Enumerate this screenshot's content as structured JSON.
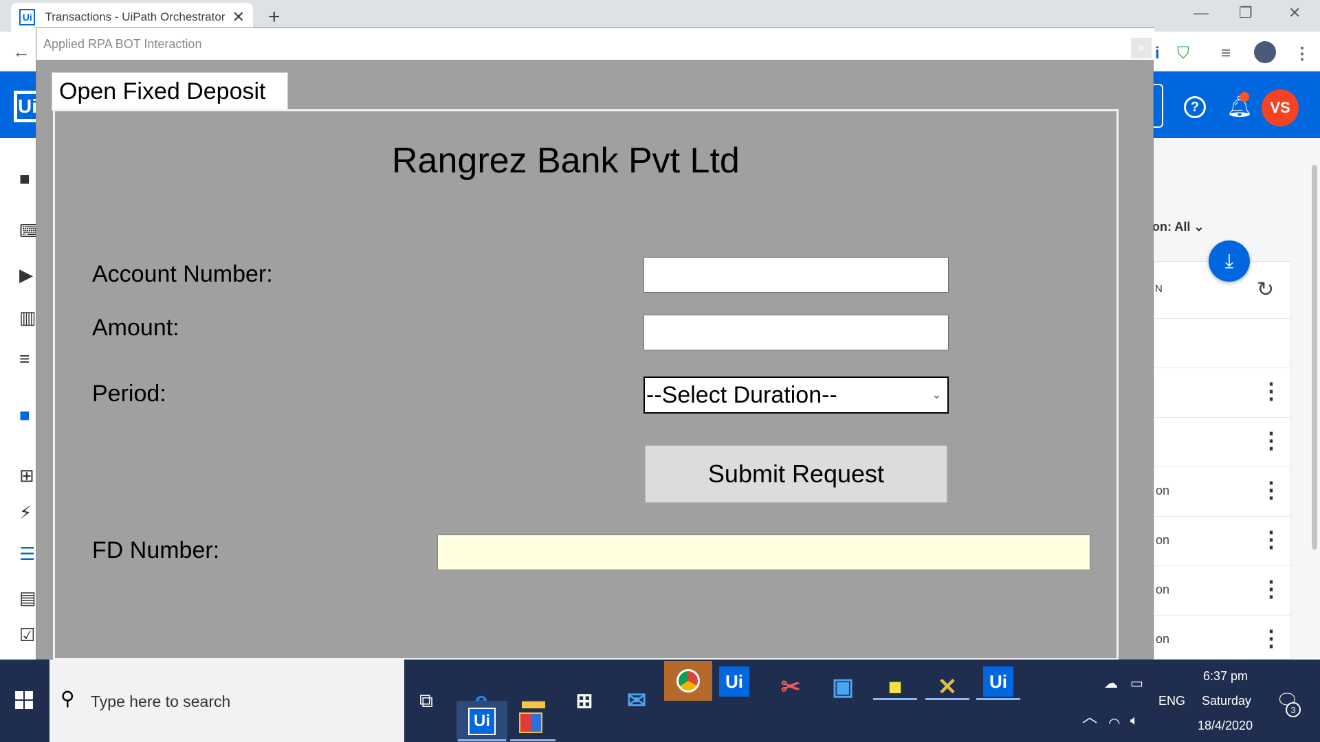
{
  "browser": {
    "tab_title": "Transactions - UiPath Orchestrator",
    "favicon_text": "Ui",
    "close_glyph": "✕",
    "newtab_glyph": "+"
  },
  "orchestrator": {
    "logo_text": "Ui",
    "help_glyph": "?",
    "avatar_initials": "VS",
    "filter_label": "on: All",
    "column_label": "N",
    "rows": [
      "",
      "",
      "",
      "on",
      "on",
      "on",
      "on"
    ]
  },
  "app": {
    "window_title": "Applied RPA BOT Interaction",
    "tab_label": "Open Fixed Deposit",
    "bank_name": "Rangrez Bank Pvt Ltd",
    "labels": {
      "account_number": "Account Number:",
      "amount": "Amount:",
      "period": "Period:",
      "fd_number": "FD Number:"
    },
    "fields": {
      "account_number": "",
      "amount": "",
      "fd_number": ""
    },
    "period_selected": "--Select Duration--",
    "submit_label": "Submit Request"
  },
  "taskbar": {
    "search_placeholder": "Type here to search",
    "time": "6:37 pm",
    "day": "Saturday",
    "date": "18/4/2020",
    "language": "ENG",
    "notification_count": "3",
    "uipath_label": "Ui"
  },
  "colors": {
    "brand": "#0067df",
    "avatar": "#f44323",
    "form_bg": "#a0a0a0",
    "fd_field_bg": "#ffffe0",
    "taskbar": "#1f2d4e"
  }
}
